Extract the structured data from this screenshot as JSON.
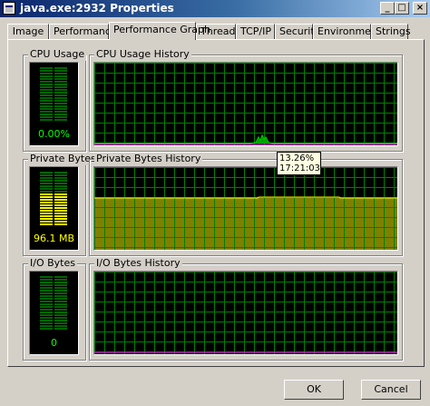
{
  "window": {
    "title": "java.exe:2932 Properties",
    "title_gradient_start": "#0a246a",
    "title_gradient_end": "#a6caf0",
    "controls": {
      "minimize": "_",
      "maximize": "□",
      "close": "×"
    }
  },
  "tabs": [
    {
      "label": "Image",
      "active": false
    },
    {
      "label": "Performance",
      "active": false
    },
    {
      "label": "Performance Graph",
      "active": true
    },
    {
      "label": "Threads",
      "active": false
    },
    {
      "label": "TCP/IP",
      "active": false
    },
    {
      "label": "Security",
      "active": false
    },
    {
      "label": "Environment",
      "active": false
    },
    {
      "label": "Strings",
      "active": false
    }
  ],
  "cpu": {
    "group_label": "CPU Usage",
    "value_text": "0.00%",
    "level": 0.0,
    "history_label": "CPU Usage History",
    "line_color": "#00ff00"
  },
  "private_bytes": {
    "group_label": "Private Bytes",
    "value_text": "96.1 MB",
    "level": 0.6,
    "history_label": "Private Bytes History",
    "fill_color": "#808000",
    "line_color": "#ffff00"
  },
  "io": {
    "group_label": "I/O Bytes",
    "value_text": "0",
    "level": 0.0,
    "history_label": "I/O Bytes History",
    "line_color": "#ff00ff"
  },
  "tooltip": {
    "line1": "13.26%",
    "line2": "17:21:03"
  },
  "grid_color": "#008000",
  "buttons": {
    "ok": "OK",
    "cancel": "Cancel"
  }
}
